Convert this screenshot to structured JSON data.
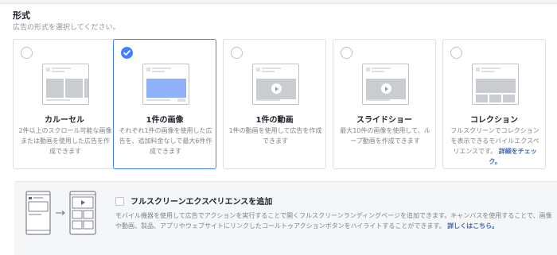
{
  "section": {
    "title": "形式",
    "subtitle": "広告の形式を選択してください。"
  },
  "formats": [
    {
      "title": "カルーセル",
      "description": "2件以上のスクロール可能な画像または動画を使用した広告を作成できます",
      "selected": false,
      "thumbnail": "carousel"
    },
    {
      "title": "1件の画像",
      "description": "それぞれ1件の画像を使用した広告を、追加料金なしで最大6件作成できます",
      "selected": true,
      "thumbnail": "single-image"
    },
    {
      "title": "1件の動画",
      "description": "1件の動画を使用して広告を作成できます",
      "selected": false,
      "thumbnail": "single-video"
    },
    {
      "title": "スライドショー",
      "description": "最大10件の画像を使用して、ループ動画を作成できます",
      "selected": false,
      "thumbnail": "slideshow"
    },
    {
      "title": "コレクション",
      "description": "フルスクリーンでコレクションを表示できるモバイルエクスペリエンスです。",
      "link": "詳細をチェック。",
      "selected": false,
      "thumbnail": "collection"
    }
  ],
  "fullscreen": {
    "checkbox_label": "フルスクリーンエクスペリエンスを追加",
    "checked": false,
    "description": "モバイル機器を使用して広告でアクションを実行することで開くフルスクリーンランディングページを追加できます。キャンバスを使用することで、画像や動画、製品、アプリやウェブサイトにリンクしたコールトゥアクションボタンをハイライトすることができます。",
    "link": "詳しくはこちら。"
  },
  "colors": {
    "accent": "#4080ff",
    "link": "#4267b2",
    "placeholder": "#c9ccd1",
    "image_highlight": "#8fb1fa"
  }
}
